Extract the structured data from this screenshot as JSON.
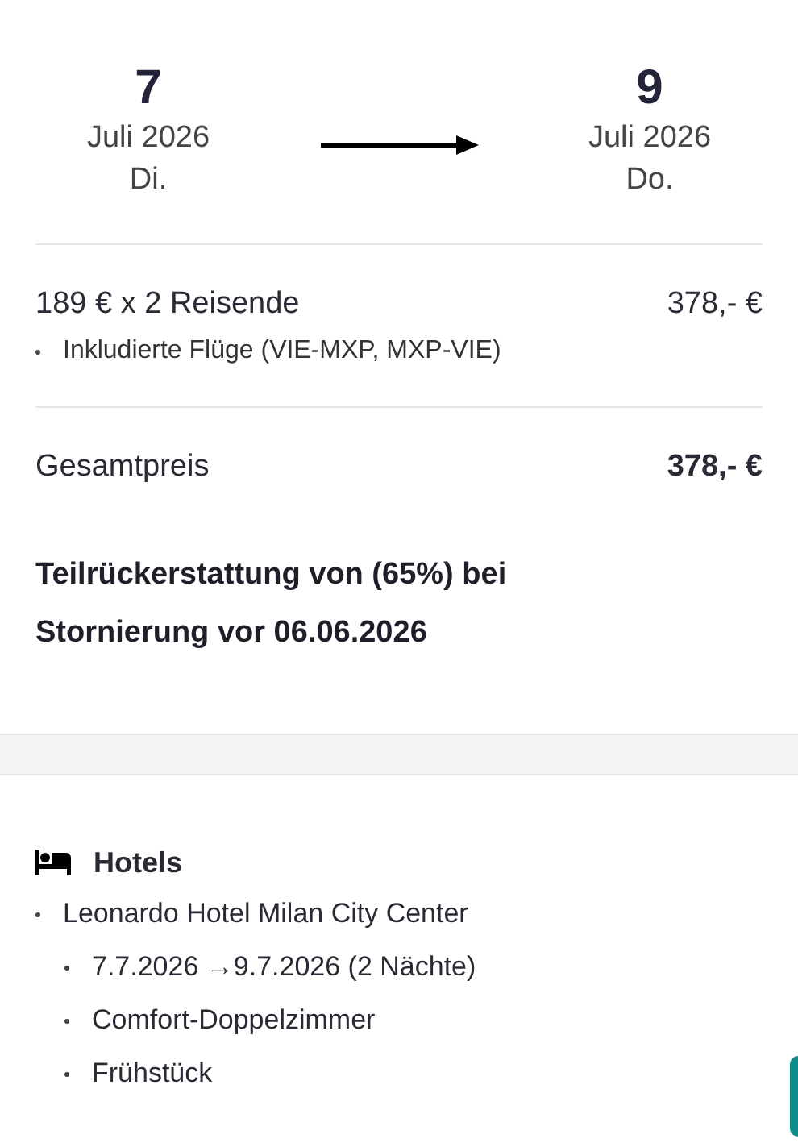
{
  "dates": {
    "start": {
      "day": "7",
      "month": "Juli 2026",
      "weekday": "Di."
    },
    "end": {
      "day": "9",
      "month": "Juli 2026",
      "weekday": "Do."
    }
  },
  "price": {
    "line": "189 € x 2 Reisende",
    "amount": "378,- €",
    "items": [
      "Inkludierte Flüge (VIE-MXP, MXP-VIE)"
    ]
  },
  "total": {
    "label": "Gesamtpreis",
    "amount": "378,- €"
  },
  "refund_note": "Teilrückerstattung von (65%) bei Stornierung vor 06.06.2026",
  "hotels": {
    "title": "Hotels",
    "items": [
      {
        "name": "Leonardo Hotel Milan City Center",
        "children": [
          "7.7.2026 →9.7.2026 (2 Nächte)",
          "Comfort-Doppelzimmer",
          "Frühstück"
        ]
      }
    ]
  }
}
